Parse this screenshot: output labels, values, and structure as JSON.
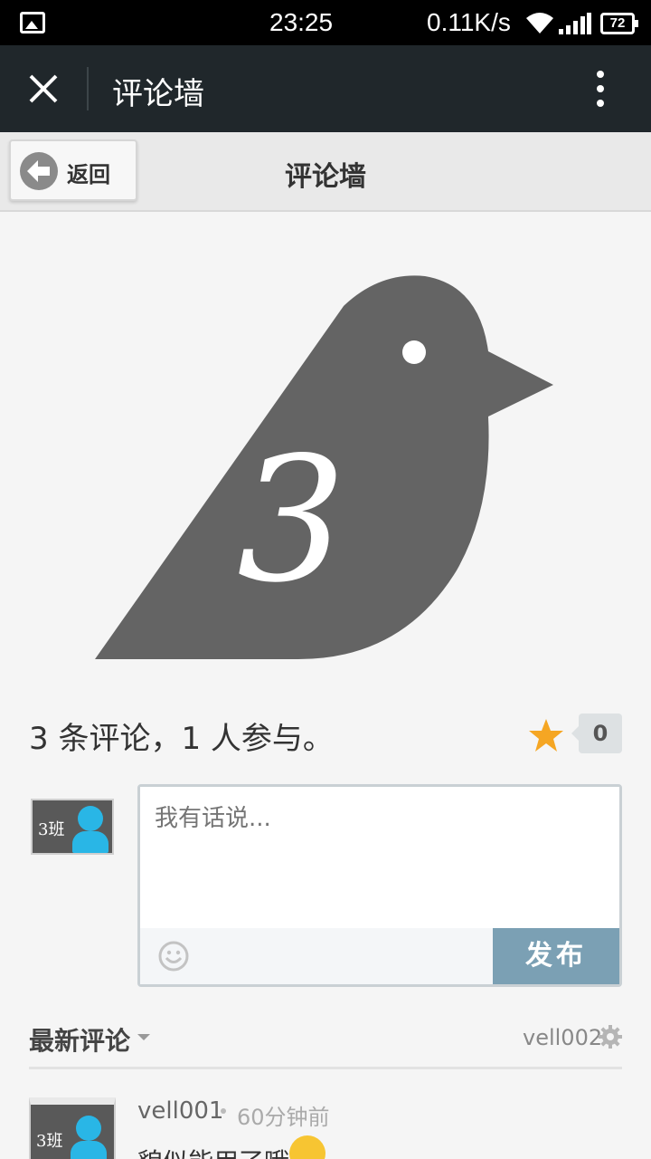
{
  "status_bar": {
    "time": "23:25",
    "speed": "0.11K/s",
    "battery": "72",
    "icons": [
      "image-icon",
      "wifi-icon",
      "signal-icon",
      "battery-icon"
    ]
  },
  "app_bar": {
    "title": "评论墙",
    "icons": [
      "close-icon",
      "more-vertical-icon"
    ]
  },
  "page_header": {
    "back_label": "返回",
    "title": "评论墙"
  },
  "logo": {
    "glyph": "3"
  },
  "summary": {
    "text": "3 条评论，1 人参与。",
    "fav_count": "0",
    "star_color": "#f5a623"
  },
  "avatar": {
    "class_label": "3班"
  },
  "comment_box": {
    "placeholder": "我有话说...",
    "publish_label": "发布"
  },
  "latest": {
    "title": "最新评论",
    "user": "vell002"
  },
  "comments": [
    {
      "user": "vell001",
      "time": "60分钟前",
      "text": "貌似能用了哦"
    }
  ],
  "colors": {
    "app_bar_bg": "#20272b",
    "publish_bg": "#7ba0b4",
    "avatar_person": "#29b6e6"
  }
}
